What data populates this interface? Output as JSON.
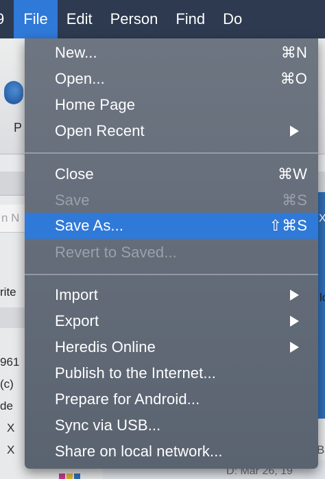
{
  "menubar": {
    "partial_left": "9",
    "items": [
      "File",
      "Edit",
      "Person",
      "Find",
      "Do"
    ]
  },
  "file_menu": {
    "groups": [
      [
        {
          "label": "New...",
          "shortcut": "⌘N",
          "enabled": true
        },
        {
          "label": "Open...",
          "shortcut": "⌘O",
          "enabled": true
        },
        {
          "label": "Home Page",
          "shortcut": "",
          "enabled": true
        },
        {
          "label": "Open Recent",
          "shortcut": "",
          "enabled": true,
          "submenu": true
        }
      ],
      [
        {
          "label": "Close",
          "shortcut": "⌘W",
          "enabled": true
        },
        {
          "label": "Save",
          "shortcut": "⌘S",
          "enabled": false
        },
        {
          "label": "Save As...",
          "shortcut": "⇧⌘S",
          "enabled": true,
          "highlighted": true
        },
        {
          "label": "Revert to Saved...",
          "shortcut": "",
          "enabled": false
        }
      ],
      [
        {
          "label": "Import",
          "shortcut": "",
          "enabled": true,
          "submenu": true
        },
        {
          "label": "Export",
          "shortcut": "",
          "enabled": true,
          "submenu": true
        },
        {
          "label": "Heredis Online",
          "shortcut": "",
          "enabled": true,
          "submenu": true
        },
        {
          "label": "Publish to the Internet...",
          "shortcut": "",
          "enabled": true
        },
        {
          "label": "Prepare for Android...",
          "shortcut": "",
          "enabled": true
        },
        {
          "label": "Sync via USB...",
          "shortcut": "",
          "enabled": true
        },
        {
          "label": "Share on local network...",
          "shortcut": "",
          "enabled": true
        }
      ]
    ]
  },
  "background": {
    "toolbar_label": "P",
    "search_placeholder_fragment": "n N",
    "close_fragment": "X",
    "write_fragment": "rite",
    "right_fragment": "lc",
    "list_rows": [
      "961",
      "(c)",
      "de",
      "X",
      "X"
    ],
    "bottom_date": "D: Mar 26, 19",
    "right_bottom_fragment": "B"
  },
  "colors": {
    "menubar_bg": "#2d3a50",
    "highlight": "#2f79d8",
    "menu_bg": "#656d79",
    "disabled_text": "#9aa1ab"
  }
}
